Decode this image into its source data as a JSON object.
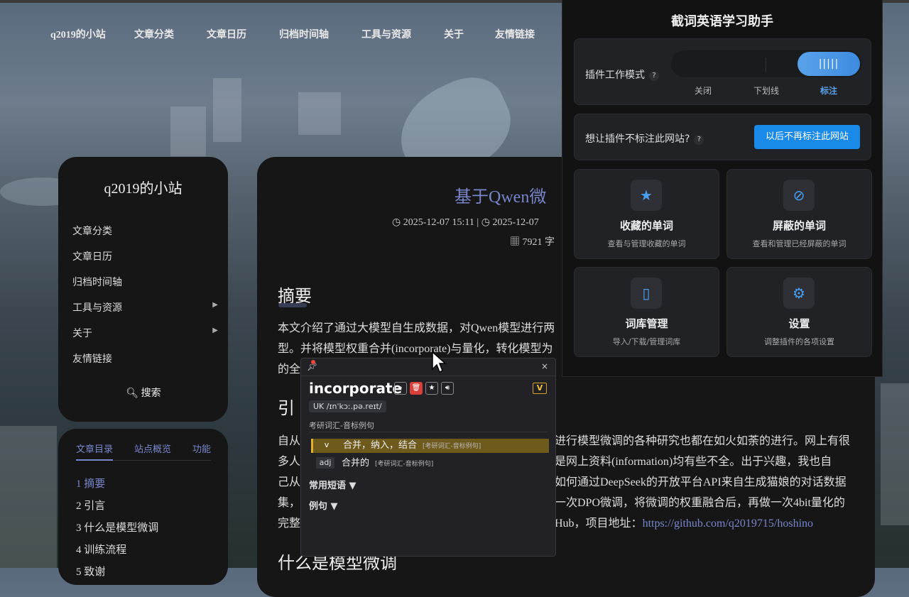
{
  "nav": {
    "items": [
      "q2019的小站",
      "文章分类",
      "文章日历",
      "归档时间轴",
      "工具与资源",
      "关于",
      "友情链接"
    ]
  },
  "sidebar": {
    "title": "q2019的小站",
    "items": [
      {
        "label": "文章分类",
        "submenu": false
      },
      {
        "label": "文章日历",
        "submenu": false
      },
      {
        "label": "归档时间轴",
        "submenu": false
      },
      {
        "label": "工具与资源",
        "submenu": true
      },
      {
        "label": "关于",
        "submenu": true
      },
      {
        "label": "友情链接",
        "submenu": false
      }
    ],
    "search_label": "搜索"
  },
  "toc": {
    "tabs": [
      "文章目录",
      "站点概览",
      "功能"
    ],
    "items": [
      "1 摘要",
      "2 引言",
      "3 什么是模型微调",
      "4 训练流程",
      "5 致谢"
    ]
  },
  "post": {
    "title": "基于Qwen微",
    "published": "2025-12-07 15:11",
    "updated": "2025-12-07",
    "separator": "|",
    "wordcount": "7921 字",
    "abstract_heading": "摘要",
    "abstract_lines": [
      "本文介绍了通过大模型自生成数据，对Qwen模型进行两",
      "型。并将模型权重合并(incorporate)与量化，转化模型为",
      "的全"
    ],
    "intro_heading": "引",
    "intro_left": [
      "自从",
      "多人",
      "己从",
      "集，",
      "完整"
    ],
    "intro_right": [
      "进行模型微调的各种研究也都在如火如荼的进行。网上有很",
      "是网上资料(information)均有些不全。出于兴趣，我也自",
      "如何通过DeepSeek的开放平台API来自生成猫娘的对话数据",
      "一次DPO微调，将微调的权重融合后，再做一次4bit量化的",
      "Hub，项目地址："
    ],
    "repo_link": "https://github.com/q2019715/hoshino",
    "next_heading": "什么是模型微调"
  },
  "popup": {
    "title": "截词英语学习助手",
    "mode_label": "插件工作模式",
    "help": "?",
    "modes": [
      "关闭",
      "下划线",
      "标注"
    ],
    "active_mode": "标注",
    "site_question": "想让插件不标注此网站?",
    "site_button": "以后不再标注此网站",
    "tiles": [
      {
        "icon": "star-icon",
        "glyph": "★",
        "title": "收藏的单词",
        "sub": "查看与管理收藏的单词"
      },
      {
        "icon": "block-icon",
        "glyph": "⊘",
        "title": "屏蔽的单词",
        "sub": "查看和管理已经屏蔽的单词"
      },
      {
        "icon": "book-icon",
        "glyph": "▯",
        "title": "词库管理",
        "sub": "导入/下载/管理词库"
      },
      {
        "icon": "gear-icon",
        "glyph": "⚙",
        "title": "设置",
        "sub": "调整插件的各项设置"
      }
    ],
    "accent": "#1a8ae8"
  },
  "dict": {
    "word": "incorporate",
    "level_badge": "V",
    "phonetic": "UK /ɪnˈkɔː.pə.reɪt/",
    "source": "考研词汇-音标例句",
    "defs": [
      {
        "pos": "v",
        "text": "合并，纳入，结合",
        "tag": "[考研词汇-音标例句]",
        "highlight": true
      },
      {
        "pos": "adj",
        "text": "合并的",
        "tag": "[考研词汇-音标例句]",
        "highlight": false
      }
    ],
    "phrases_label": "常用短语 ▼",
    "examples_label": "例句 ▼",
    "close": "×"
  }
}
